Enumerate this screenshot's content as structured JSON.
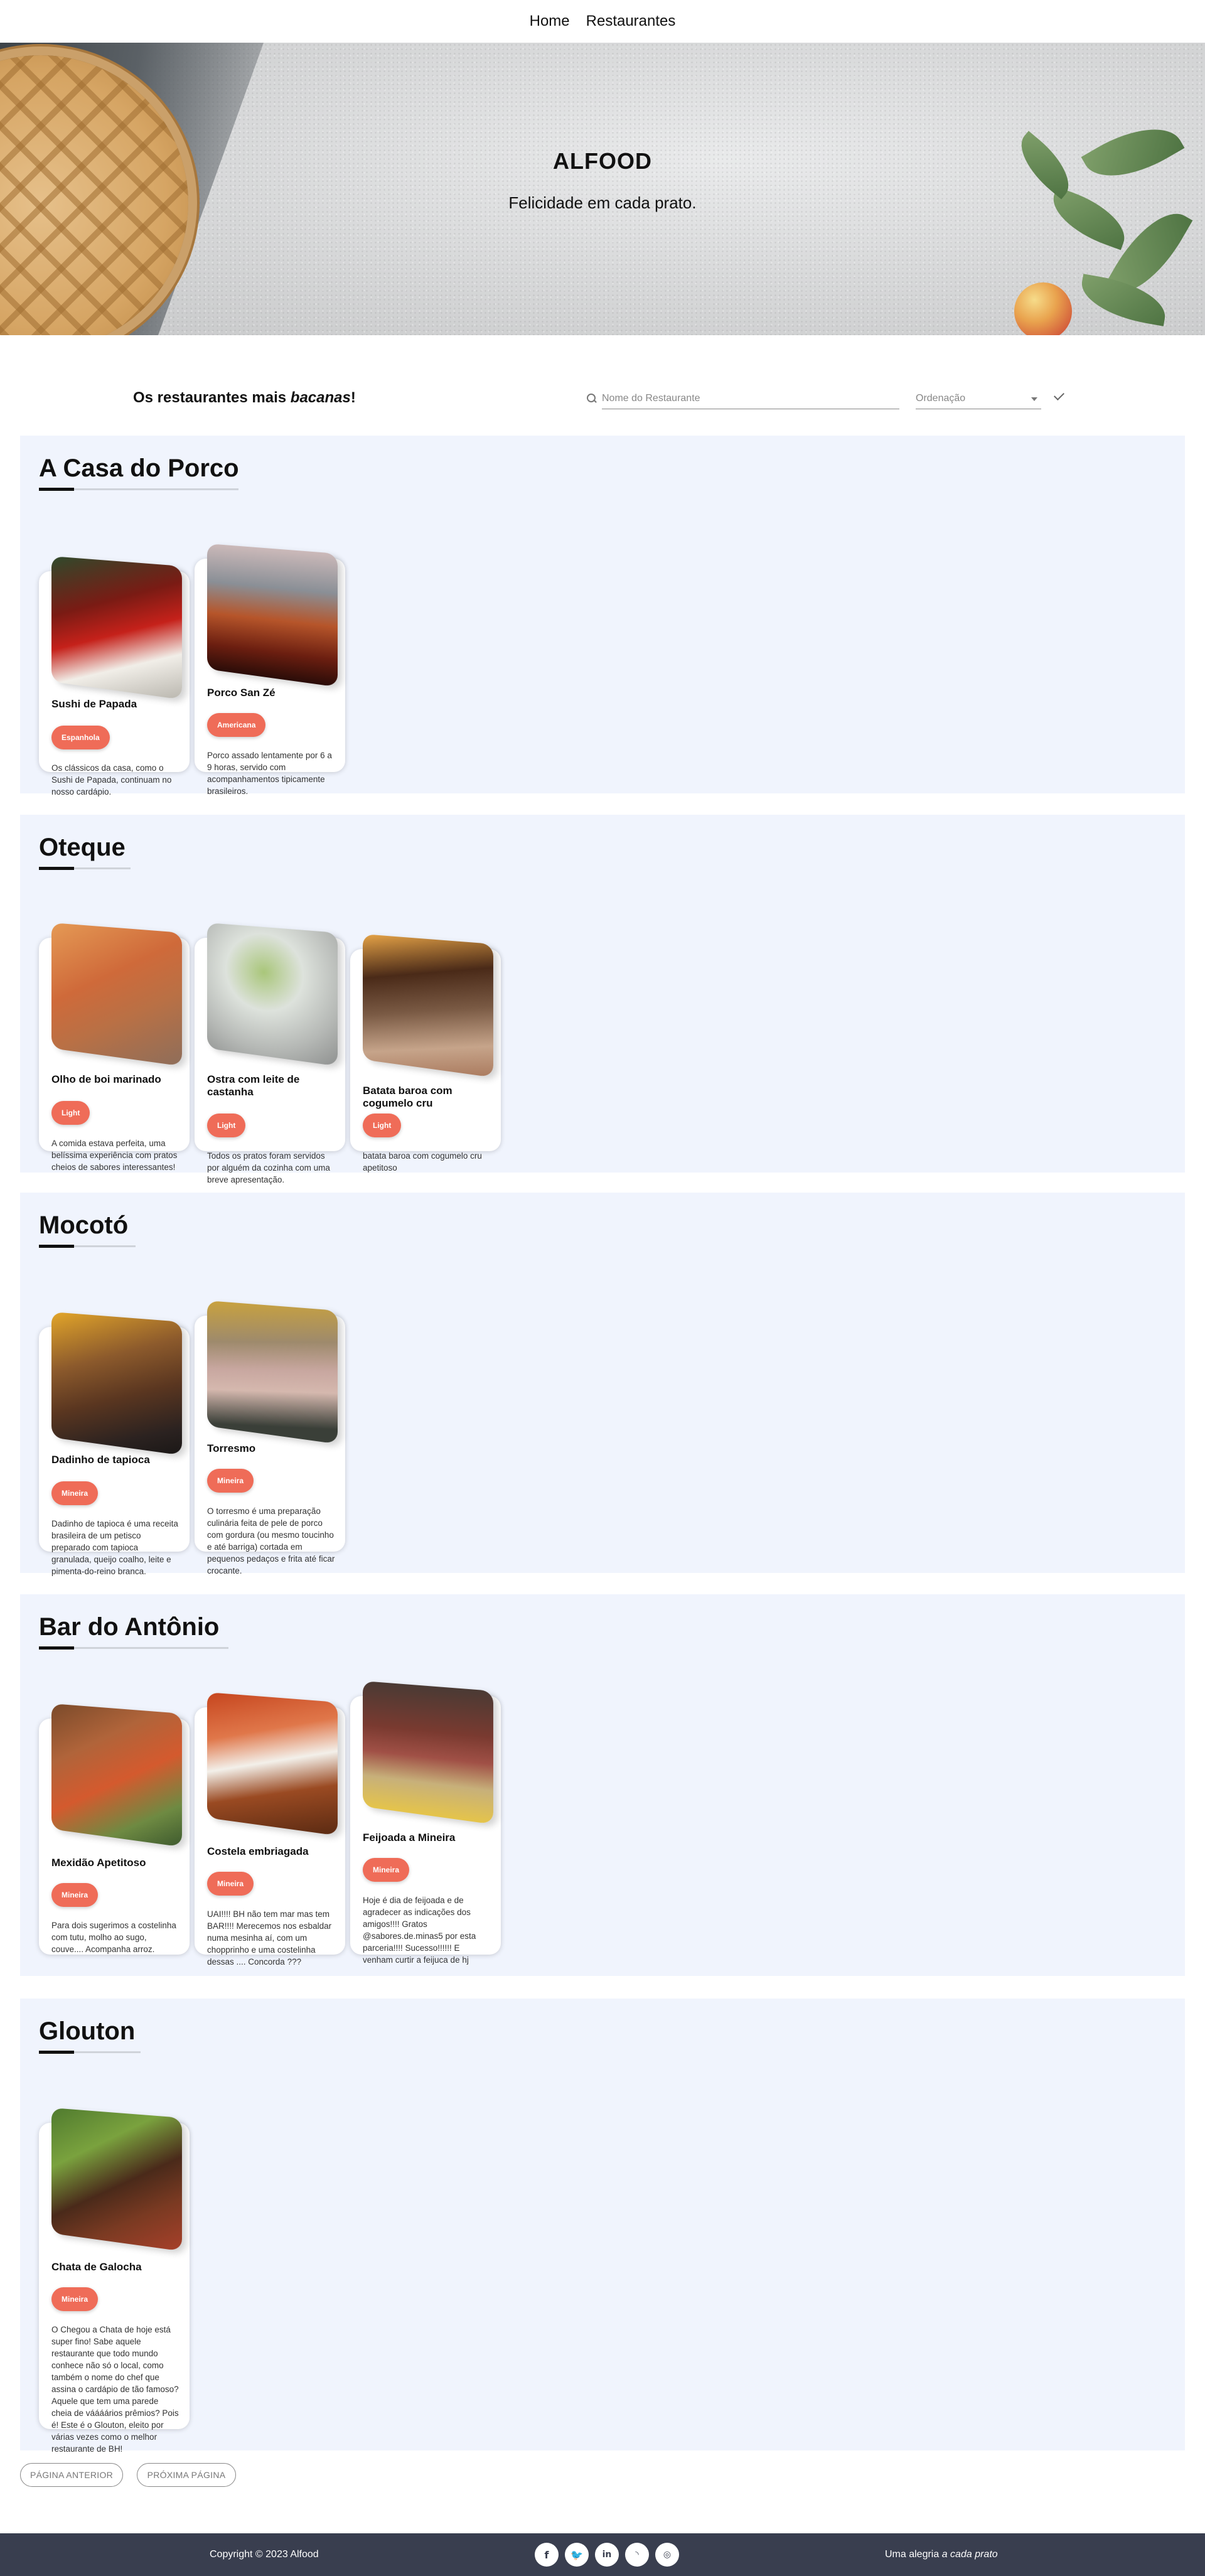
{
  "nav": {
    "home": "Home",
    "restaurants": "Restaurantes"
  },
  "hero": {
    "title": "ALFOOD",
    "subtitle": "Felicidade em cada prato."
  },
  "filters": {
    "headline_prefix": "Os restaurantes mais ",
    "headline_emphasis": "bacanas",
    "headline_suffix": "!",
    "search_placeholder": "Nome do Restaurante",
    "order_label": "Ordenação"
  },
  "restaurants": [
    {
      "name": "A Casa do Porco",
      "dishes": [
        {
          "name": "Sushi de Papada",
          "tag": "Espanhola",
          "description": "Os clássicos da casa, como o Sushi de Papada, continuam no nosso cardápio."
        },
        {
          "name": "Porco San Zé",
          "tag": "Americana",
          "description": "Porco assado lentamente por 6 a 9 horas, servido com acompanhamentos tipicamente brasileiros."
        }
      ]
    },
    {
      "name": "Oteque",
      "dishes": [
        {
          "name": "Olho de boi marinado",
          "tag": "Light",
          "description": "A comida estava perfeita, uma belíssima experiência com pratos cheios de sabores interessantes!"
        },
        {
          "name": "Ostra com leite de castanha",
          "tag": "Light",
          "description": "Todos os pratos foram servidos por alguém da cozinha com uma breve apresentação."
        },
        {
          "name": "Batata baroa com cogumelo cru",
          "tag": "Light",
          "description": "batata baroa com cogumelo cru apetitoso"
        }
      ]
    },
    {
      "name": "Mocotó",
      "dishes": [
        {
          "name": "Dadinho de tapioca",
          "tag": "Mineira",
          "description": "Dadinho de tapioca é uma receita brasileira de um petisco preparado com tapioca granulada, queijo coalho, leite e pimenta-do-reino branca."
        },
        {
          "name": "Torresmo",
          "tag": "Mineira",
          "description": "O torresmo é uma preparação culinária feita de pele de porco com gordura (ou mesmo toucinho e até barriga) cortada em pequenos pedaços e frita até ficar crocante."
        }
      ]
    },
    {
      "name": "Bar do Antônio",
      "dishes": [
        {
          "name": "Mexidão Apetitoso",
          "tag": "Mineira",
          "description": "Para dois sugerimos a costelinha com tutu, molho ao sugo, couve.... Acompanha arroz."
        },
        {
          "name": "Costela embriagada",
          "tag": "Mineira",
          "description": "UAI!!!! BH não tem mar mas tem BAR!!!! Merecemos nos esbaldar numa mesinha aí, com um chopprinho e uma costelinha dessas .... Concorda ???"
        },
        {
          "name": "Feijoada a Mineira",
          "tag": "Mineira",
          "description": "Hoje é dia de feijoada e de agradecer as indicações dos amigos!!!! Gratos @sabores.de.minas5 por esta parceria!!!! Sucesso!!!!!! E venham curtir a feijuca de hj"
        }
      ]
    },
    {
      "name": "Glouton",
      "dishes": [
        {
          "name": "Chata de Galocha",
          "tag": "Mineira",
          "description": "O Chegou a Chata de hoje está super fino! Sabe aquele restaurante que todo mundo conhece não só o local, como também o nome do chef que assina o cardápio de tão famoso? Aquele que tem uma parede cheia de váááários prêmios? Pois é! Este é o Glouton, eleito por várias vezes como o melhor restaurante de BH!"
        }
      ]
    }
  ],
  "pagination": {
    "previous": "PÁGINA ANTERIOR",
    "next": "PRÓXIMA PÁGINA"
  },
  "footer": {
    "copyright": "Copyright © 2023 Alfood",
    "socials": [
      "facebook-icon",
      "twitter-icon",
      "linkedin-icon",
      "rss-icon",
      "instagram-icon"
    ],
    "tagline_prefix": "Uma alegria ",
    "tagline_emphasis": "a cada prato"
  },
  "colors": {
    "tag": "#ef6c58",
    "section_bg": "#f0f4fd",
    "footer_bg": "#393e4f"
  }
}
